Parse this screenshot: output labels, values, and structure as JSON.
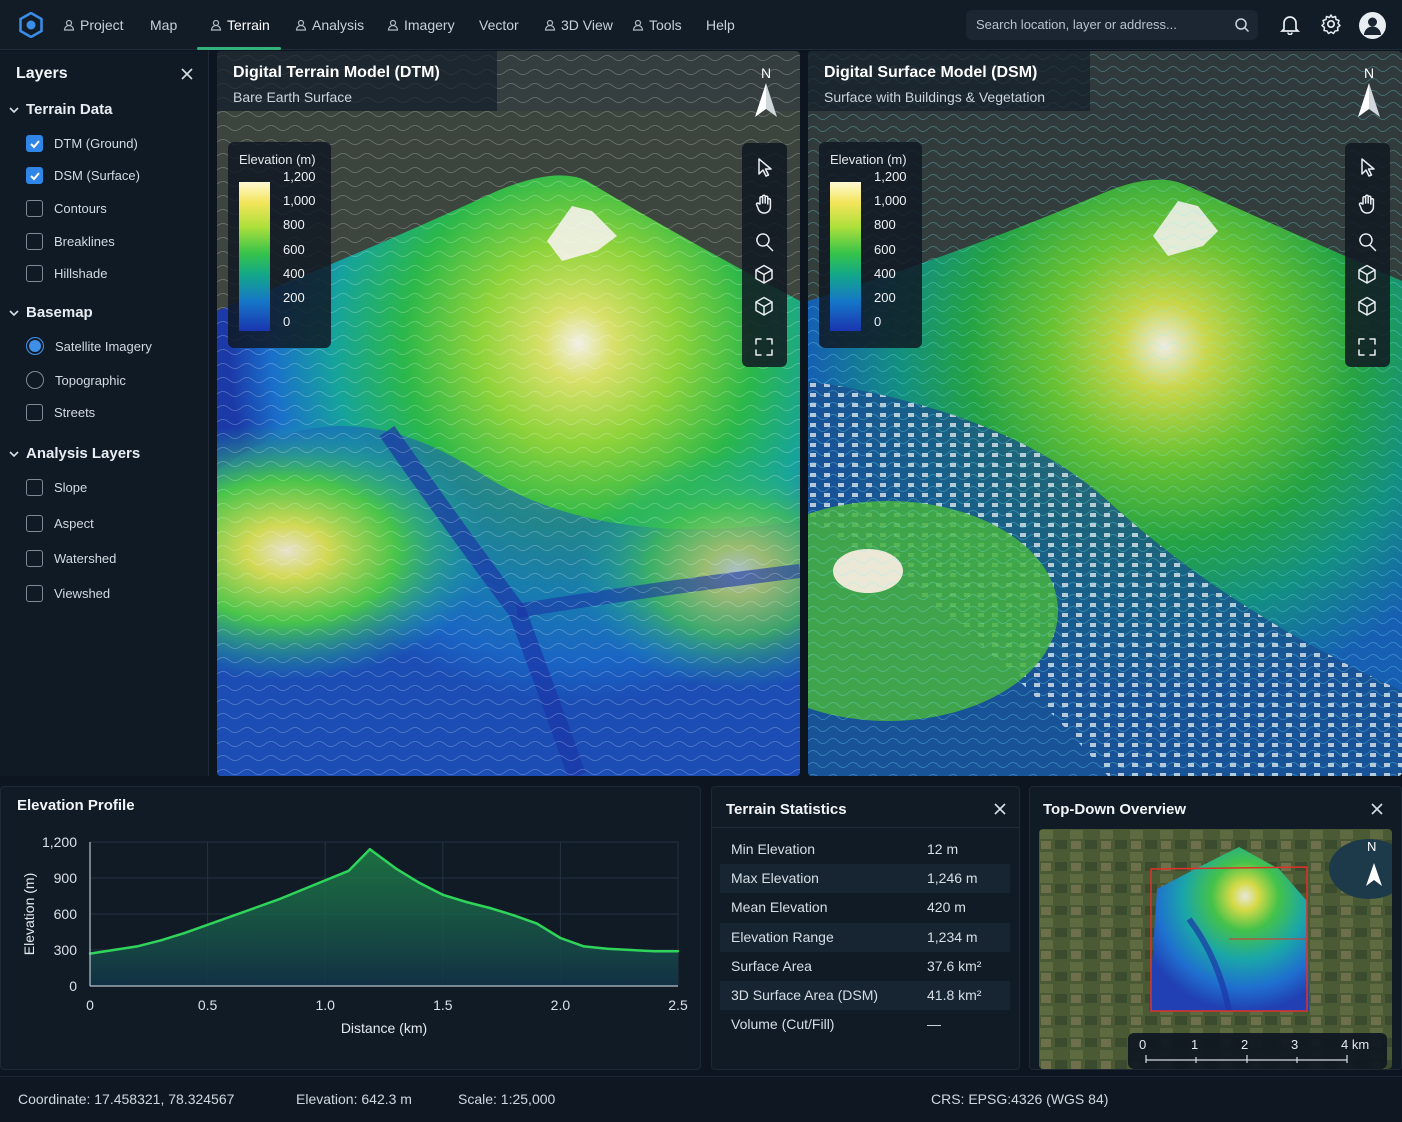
{
  "nav": {
    "items": [
      {
        "label": "Project",
        "icon": true
      },
      {
        "label": "Map",
        "icon": false
      },
      {
        "label": "Terrain",
        "icon": true,
        "active": true
      },
      {
        "label": "Analysis",
        "icon": true
      },
      {
        "label": "Imagery",
        "icon": true
      },
      {
        "label": "Vector",
        "icon": false
      },
      {
        "label": "3D View",
        "icon": true
      },
      {
        "label": "Tools",
        "icon": true
      },
      {
        "label": "Help",
        "icon": false
      }
    ]
  },
  "search": {
    "placeholder": "Search location, layer or address..."
  },
  "layers": {
    "title": "Layers",
    "groups": [
      {
        "label": "Terrain Data",
        "items": [
          "DTM (Ground)",
          "DSM (Surface)",
          "Contours",
          "Breaklines",
          "Hillshade"
        ]
      },
      {
        "label": "Basemap",
        "items": [
          "Satellite Imagery",
          "Topographic",
          "Streets"
        ]
      },
      {
        "label": "Analysis Layers",
        "items": [
          "Slope",
          "Aspect",
          "Watershed",
          "Viewshed"
        ]
      }
    ],
    "checked": [
      "DTM (Ground)",
      "DSM (Surface)"
    ],
    "selected_basemap": "Satellite Imagery"
  },
  "dtm": {
    "title": "Digital Terrain Model (DTM)",
    "subtitle": "Bare Earth Surface"
  },
  "dsm": {
    "title": "Digital Surface Model (DSM)",
    "subtitle": "Surface with Buildings & Vegetation"
  },
  "north_label": "N",
  "legend": {
    "title": "Elevation (m)",
    "values": [
      "1,200",
      "1,000",
      "800",
      "600",
      "400",
      "200",
      "0"
    ]
  },
  "profile": {
    "title": "Elevation Profile",
    "chart_data": {
      "type": "area",
      "xlabel": "Distance (km)",
      "ylabel": "Elevation (m)",
      "xlim": [
        0,
        2.5
      ],
      "ylim": [
        0,
        1200
      ],
      "xticks": [
        "0",
        "0.5",
        "1.0",
        "1.5",
        "2.0",
        "2.5"
      ],
      "yticks": [
        "0",
        "300",
        "600",
        "900",
        "1,200"
      ],
      "x": [
        0,
        0.1,
        0.2,
        0.3,
        0.4,
        0.5,
        0.6,
        0.7,
        0.8,
        0.9,
        1.0,
        1.1,
        1.19,
        1.3,
        1.4,
        1.5,
        1.6,
        1.7,
        1.8,
        1.9,
        2.0,
        2.1,
        2.2,
        2.3,
        2.4,
        2.5
      ],
      "y": [
        270,
        300,
        330,
        380,
        440,
        510,
        580,
        650,
        720,
        800,
        880,
        960,
        1140,
        980,
        860,
        760,
        700,
        650,
        590,
        520,
        400,
        330,
        310,
        300,
        290,
        290
      ],
      "color": "#2fd45a"
    }
  },
  "stats": {
    "title": "Terrain Statistics",
    "rows": [
      {
        "label": "Min Elevation",
        "value": "12 m"
      },
      {
        "label": "Max Elevation",
        "value": "1,246 m"
      },
      {
        "label": "Mean Elevation",
        "value": "420 m"
      },
      {
        "label": "Elevation Range",
        "value": "1,234 m"
      },
      {
        "label": "Surface Area",
        "value": "37.6 km²"
      },
      {
        "label": "3D Surface Area (DSM)",
        "value": "41.8 km²"
      },
      {
        "label": "Volume (Cut/Fill)",
        "value": "—"
      }
    ]
  },
  "overview": {
    "title": "Top-Down Overview",
    "scale_labels": [
      "0",
      "1",
      "2",
      "3",
      "4 km"
    ]
  },
  "status": {
    "coordinate": "Coordinate:  17.458321, 78.324567",
    "elevation": "Elevation: 642.3 m",
    "scale": "Scale: 1:25,000",
    "crs": "CRS: EPSG:4326  (WGS 84)"
  },
  "colors": {
    "accent": "#34b27b",
    "checkbox": "#2f86e6",
    "profile_line": "#2fd45a"
  }
}
